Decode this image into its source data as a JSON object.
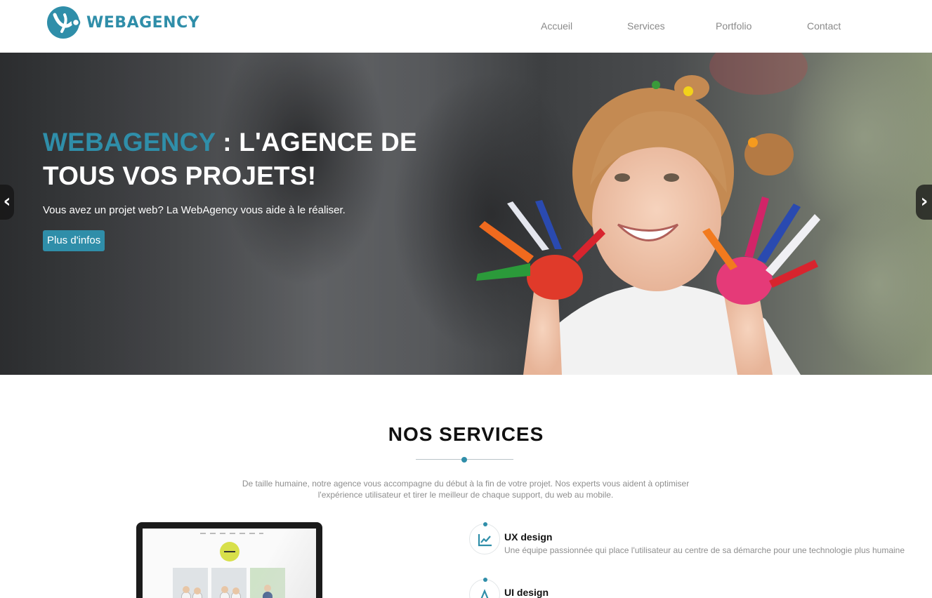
{
  "header": {
    "logo_text": "WEBAGENCY",
    "nav": [
      "Accueil",
      "Services",
      "Portfolio",
      "Contact"
    ]
  },
  "hero": {
    "brand": "WEBAGENCY",
    "title_rest": " : L'AGENCE DE TOUS VOS PROJETS!",
    "subtitle": "Vous avez un projet web? La WebAgency vous aide à le réaliser.",
    "button": "Plus d'infos",
    "prev_icon": "chevron-left-icon",
    "next_icon": "chevron-right-icon"
  },
  "services": {
    "title": "NOS SERVICES",
    "description": "De taille humaine, notre agence vous accompagne du début à la fin de votre projet. Nos experts vous aident à optimiser l'expérience utilisateur et tirer le meilleur de chaque support, du web au mobile.",
    "items": [
      {
        "title": "UX design",
        "text": "Une équipe passionnée qui place l'utilisateur au centre de sa démarche pour une technologie plus humaine",
        "icon": "line-chart-icon"
      },
      {
        "title": "UI design",
        "text": "",
        "icon": "design-icon"
      }
    ]
  },
  "colors": {
    "accent": "#2f8ea9",
    "nav_text": "#8a8a8a",
    "muted_text": "#8e8e8e"
  }
}
